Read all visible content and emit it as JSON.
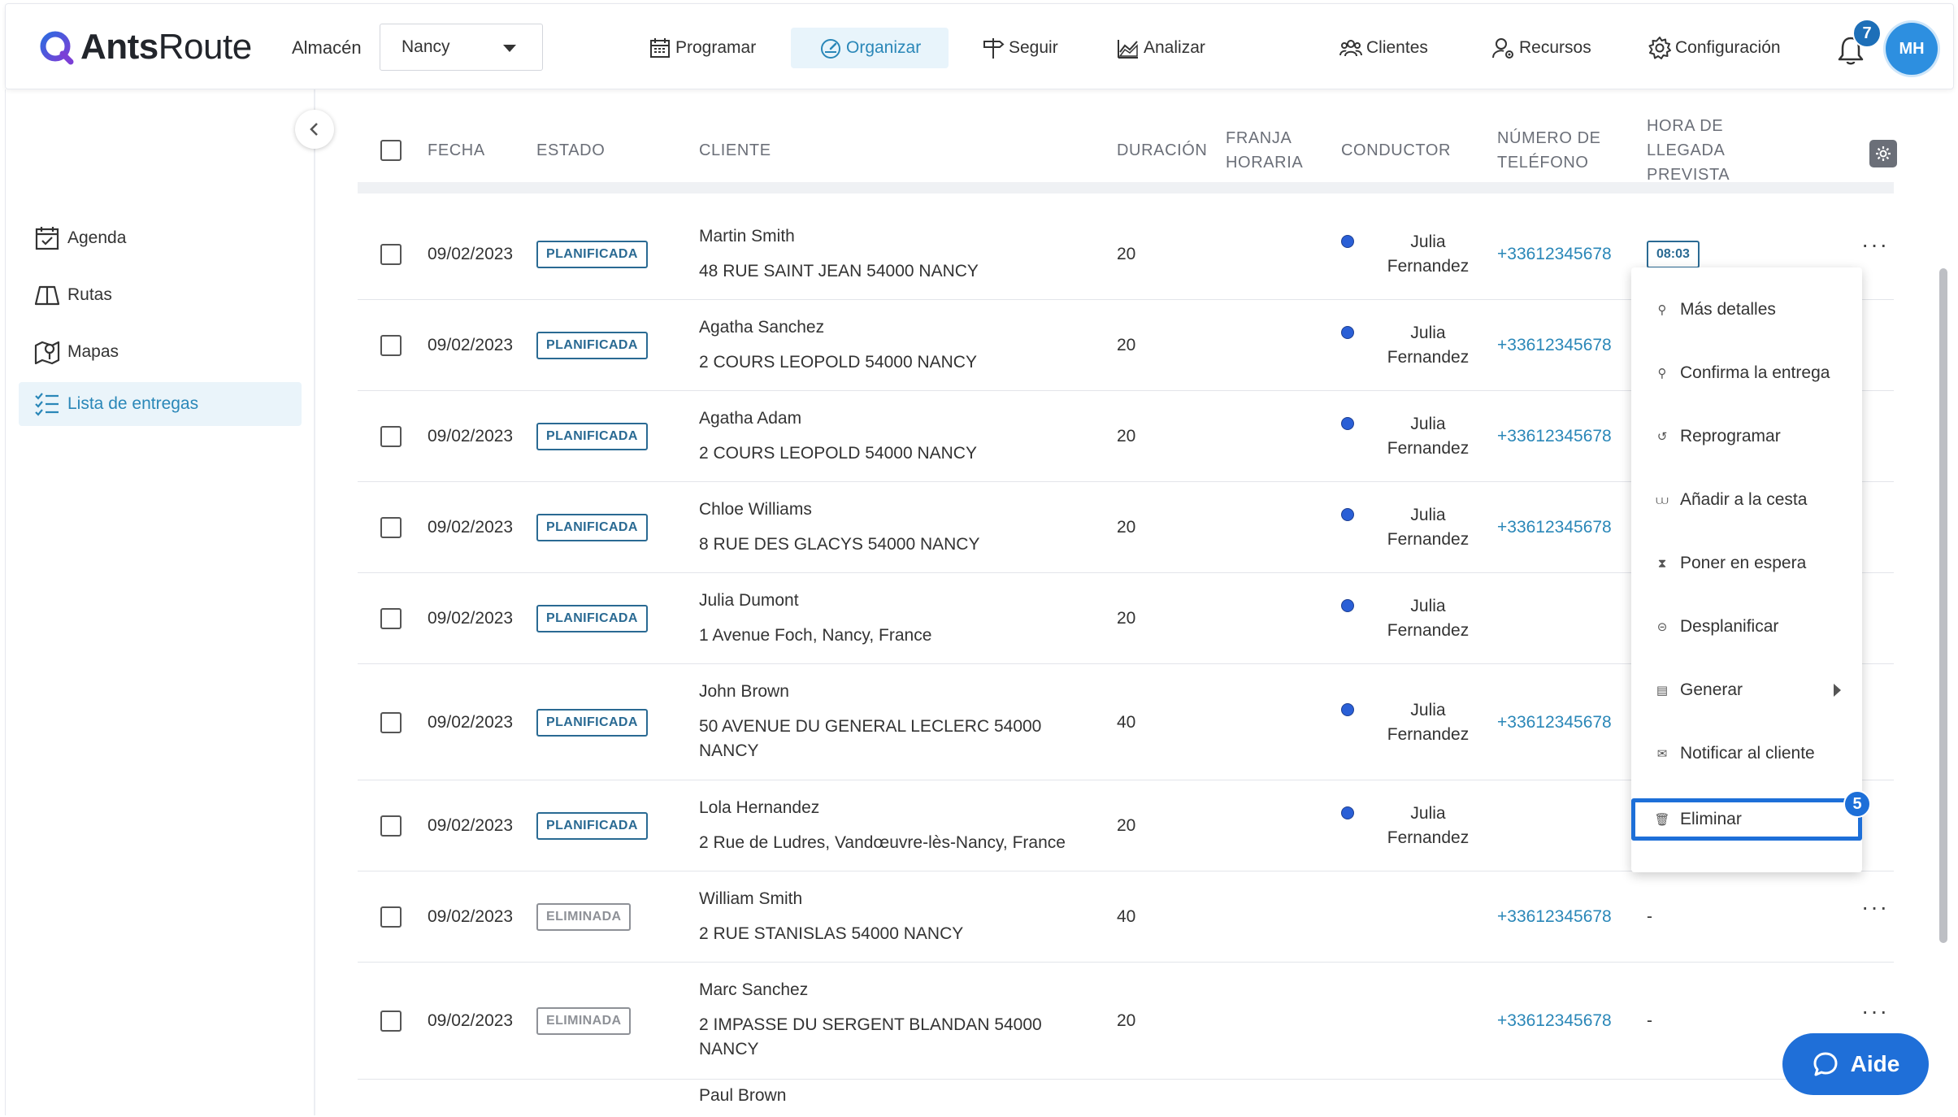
{
  "app": {
    "logo_bold": "Ants",
    "logo_light": "Route"
  },
  "header": {
    "warehouse_label": "Almacén",
    "warehouse_value": "Nancy",
    "nav": [
      {
        "label": "Programar",
        "icon": "calendar-icon"
      },
      {
        "label": "Organizar",
        "icon": "gauge-icon",
        "active": true
      },
      {
        "label": "Seguir",
        "icon": "signpost-icon"
      },
      {
        "label": "Analizar",
        "icon": "chart-icon"
      },
      {
        "label": "Clientes",
        "icon": "users-icon"
      },
      {
        "label": "Recursos",
        "icon": "user-gear-icon"
      },
      {
        "label": "Configuración",
        "icon": "gear-icon"
      }
    ],
    "notifications": "7",
    "avatar_initials": "MH"
  },
  "sidebar": {
    "items": [
      {
        "label": "Agenda",
        "icon": "calendar-check-icon"
      },
      {
        "label": "Rutas",
        "icon": "book-open-icon"
      },
      {
        "label": "Mapas",
        "icon": "map-pin-icon"
      },
      {
        "label": "Lista de entregas",
        "icon": "list-check-icon",
        "active": true
      }
    ]
  },
  "table": {
    "headers": {
      "fecha": "FECHA",
      "estado": "ESTADO",
      "cliente": "CLIENTE",
      "duracion": "DURACIÓN",
      "franja_1": "FRANJA",
      "franja_2": "HORARIA",
      "conductor": "CONDUCTOR",
      "telefono_1": "NÚMERO DE",
      "telefono_2": "TELÉFONO",
      "hora_1": "HORA DE",
      "hora_2": "LLEGADA",
      "hora_3": "PREVISTA"
    },
    "rows": [
      {
        "fecha": "09/02/2023",
        "estado": "PLANIFICADA",
        "nombre": "Martin Smith",
        "direccion": "48 RUE SAINT JEAN 54000 NANCY",
        "direccion2": "",
        "duracion": "20",
        "conductor1": "Julia",
        "conductor2": "Fernandez",
        "telefono": "+33612345678",
        "hora": "08:03"
      },
      {
        "fecha": "09/02/2023",
        "estado": "PLANIFICADA",
        "nombre": "Agatha Sanchez",
        "direccion": "2 COURS LEOPOLD 54000 NANCY",
        "direccion2": "",
        "duracion": "20",
        "conductor1": "Julia",
        "conductor2": "Fernandez",
        "telefono": "+33612345678",
        "hora": ""
      },
      {
        "fecha": "09/02/2023",
        "estado": "PLANIFICADA",
        "nombre": "Agatha Adam",
        "direccion": "2 COURS LEOPOLD 54000 NANCY",
        "direccion2": "",
        "duracion": "20",
        "conductor1": "Julia",
        "conductor2": "Fernandez",
        "telefono": "+33612345678",
        "hora": ""
      },
      {
        "fecha": "09/02/2023",
        "estado": "PLANIFICADA",
        "nombre": "Chloe Williams",
        "direccion": "8 RUE DES GLACYS 54000 NANCY",
        "direccion2": "",
        "duracion": "20",
        "conductor1": "Julia",
        "conductor2": "Fernandez",
        "telefono": "+33612345678",
        "hora": ""
      },
      {
        "fecha": "09/02/2023",
        "estado": "PLANIFICADA",
        "nombre": "Julia Dumont",
        "direccion": "1 Avenue Foch, Nancy, France",
        "direccion2": "",
        "duracion": "20",
        "conductor1": "Julia",
        "conductor2": "Fernandez",
        "telefono": "",
        "hora": ""
      },
      {
        "fecha": "09/02/2023",
        "estado": "PLANIFICADA",
        "nombre": "John Brown",
        "direccion": "50 AVENUE DU GENERAL LECLERC 54000",
        "direccion2": "NANCY",
        "duracion": "40",
        "conductor1": "Julia",
        "conductor2": "Fernandez",
        "telefono": "+33612345678",
        "hora": ""
      },
      {
        "fecha": "09/02/2023",
        "estado": "PLANIFICADA",
        "nombre": "Lola Hernandez",
        "direccion": "2 Rue de Ludres, Vandœuvre-lès-Nancy, France",
        "direccion2": "",
        "duracion": "20",
        "conductor1": "Julia",
        "conductor2": "Fernandez",
        "telefono": "",
        "hora": ""
      },
      {
        "fecha": "09/02/2023",
        "estado": "ELIMINADA",
        "nombre": "William Smith",
        "direccion": "2 RUE STANISLAS 54000 NANCY",
        "direccion2": "",
        "duracion": "40",
        "conductor1": "",
        "conductor2": "",
        "telefono": "+33612345678",
        "hora": "-"
      },
      {
        "fecha": "09/02/2023",
        "estado": "ELIMINADA",
        "nombre": "Marc Sanchez",
        "direccion": "2 IMPASSE DU SERGENT BLANDAN 54000",
        "direccion2": "NANCY",
        "duracion": "20",
        "conductor1": "",
        "conductor2": "",
        "telefono": "+33612345678",
        "hora": "-"
      },
      {
        "fecha": "",
        "estado": "",
        "nombre": "Paul Brown",
        "direccion": "",
        "direccion2": "",
        "duracion": "",
        "conductor1": "",
        "conductor2": "",
        "telefono": "",
        "hora": ""
      }
    ],
    "more_glyph": "···"
  },
  "context_menu": {
    "items": [
      {
        "label": "Más detalles",
        "icon": "search-icon",
        "glyph": "⚲"
      },
      {
        "label": "Confirma la entrega",
        "icon": "pin-icon",
        "glyph": "⚲"
      },
      {
        "label": "Reprogramar",
        "icon": "history-icon",
        "glyph": "↺"
      },
      {
        "label": "Añadir a la cesta",
        "icon": "basket-icon",
        "glyph": "⩊"
      },
      {
        "label": "Poner en espera",
        "icon": "hourglass-icon",
        "glyph": "⧗"
      },
      {
        "label": "Desplanificar",
        "icon": "minus-circle-icon",
        "glyph": "⊝"
      },
      {
        "label": "Generar",
        "icon": "document-icon",
        "glyph": "▤"
      },
      {
        "label": "Notificar al cliente",
        "icon": "mail-icon",
        "glyph": "✉"
      },
      {
        "label": "Eliminar",
        "icon": "trash-icon",
        "glyph": "🗑"
      }
    ],
    "step_badge": "5"
  },
  "help": {
    "label": "Aide"
  },
  "colors": {
    "accent": "#2a87b8",
    "primary": "#1d6fd8",
    "badge": "#2a6a93",
    "removed": "#8e9197"
  }
}
